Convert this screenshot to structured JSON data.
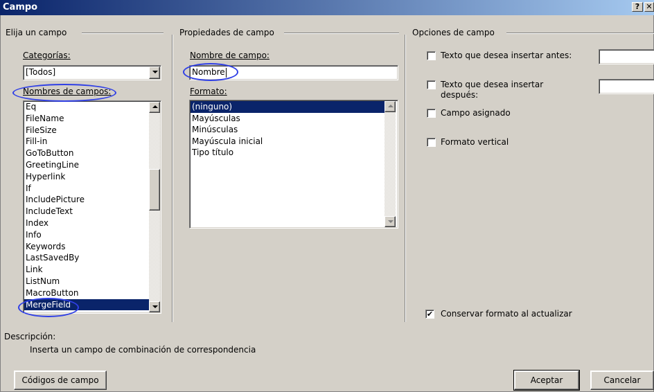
{
  "window": {
    "title": "Campo",
    "help_label": "?",
    "close_label": "✕"
  },
  "left_panel": {
    "group_title": "Elija un campo",
    "categories_label": "Categorías:",
    "categories_value": "[Todos]",
    "field_names_label": "Nombres de campos:",
    "field_names": [
      "Eq",
      "FileName",
      "FileSize",
      "Fill-in",
      "GoToButton",
      "GreetingLine",
      "Hyperlink",
      "If",
      "IncludePicture",
      "IncludeText",
      "Index",
      "Info",
      "Keywords",
      "LastSavedBy",
      "Link",
      "ListNum",
      "MacroButton",
      "MergeField"
    ],
    "selected_field": "MergeField"
  },
  "middle_panel": {
    "group_title": "Propiedades de campo",
    "field_name_label": "Nombre de campo:",
    "field_name_value": "Nombre",
    "format_label": "Formato:",
    "formats": [
      "(ninguno)",
      "Mayúsculas",
      "Minúsculas",
      "Mayúscula inicial",
      "Tipo título"
    ],
    "selected_format": "(ninguno)"
  },
  "right_panel": {
    "group_title": "Opciones de campo",
    "options": [
      {
        "label": "Texto que desea insertar antes:",
        "checked": false
      },
      {
        "label": "Texto que desea insertar",
        "label2": "después:",
        "checked": false
      },
      {
        "label": "Campo asignado",
        "checked": false
      },
      {
        "label": "Formato vertical",
        "checked": false
      }
    ],
    "preserve_label": "Conservar formato al actualizar",
    "preserve_checked": true
  },
  "description": {
    "label": "Descripción:",
    "text": "Inserta un campo de combinación de correspondencia"
  },
  "buttons": {
    "field_codes": "Códigos de campo",
    "ok": "Aceptar",
    "cancel": "Cancelar"
  },
  "colors": {
    "title_bar": "#0a246a",
    "selection": "#0a246a",
    "face": "#d4d0c8",
    "annotation_circle": "#2f3fe6"
  }
}
